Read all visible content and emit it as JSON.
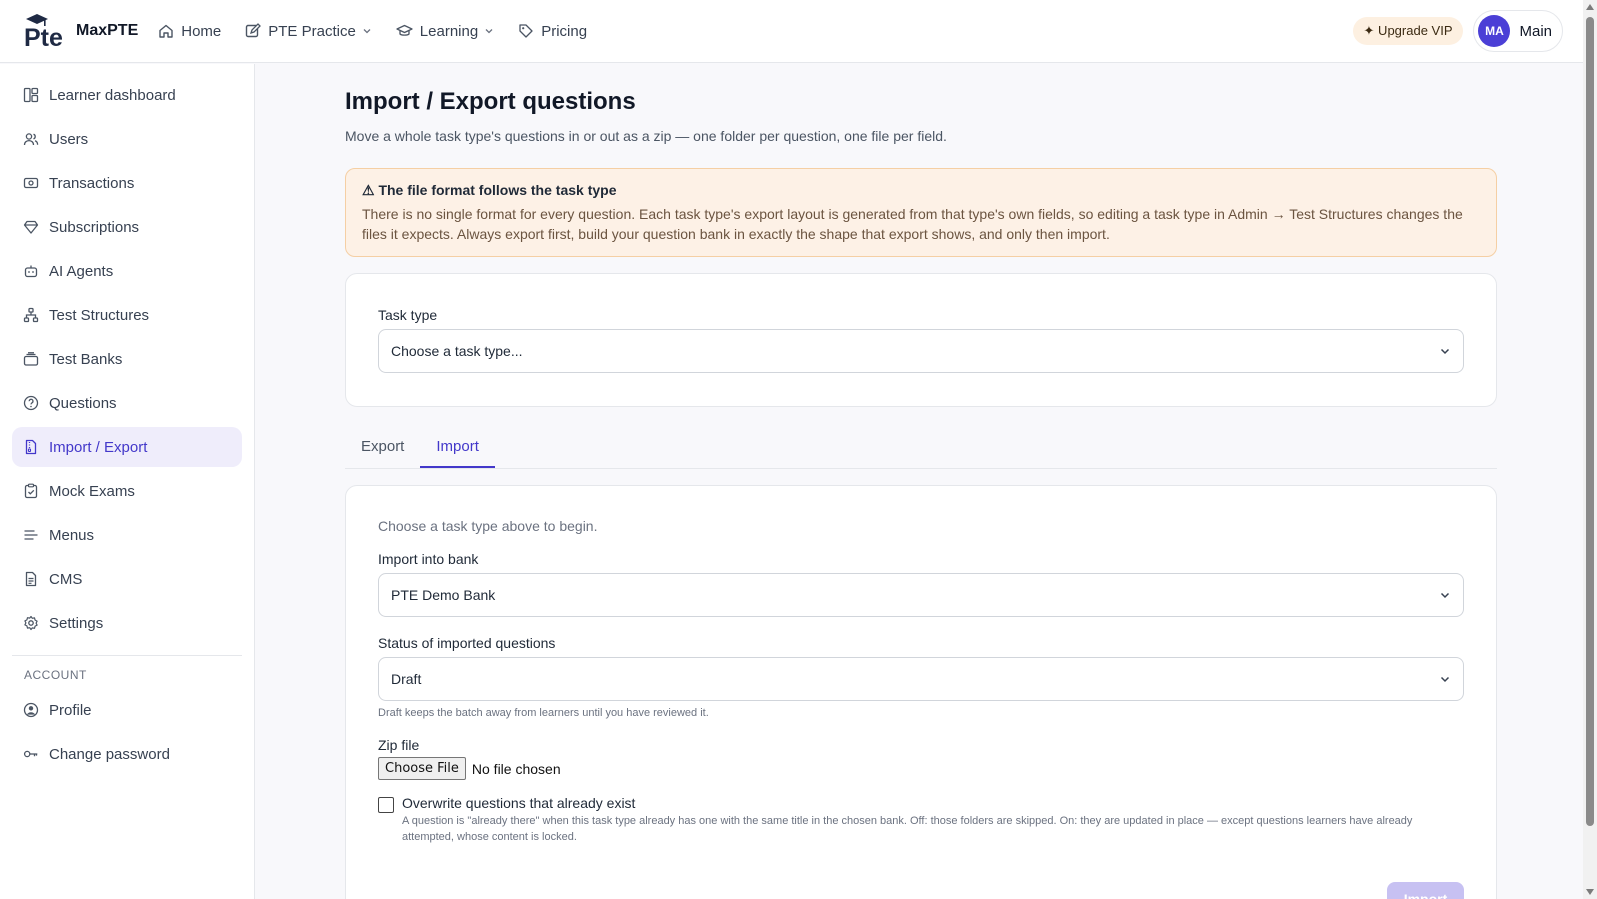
{
  "app": {
    "name": "MaxPTE",
    "logo_text": "Pte"
  },
  "topnav": {
    "items": [
      {
        "label": "Home",
        "icon": "home-icon",
        "has_dropdown": false
      },
      {
        "label": "PTE Practice",
        "icon": "edit-icon",
        "has_dropdown": true
      },
      {
        "label": "Learning",
        "icon": "graduation-cap-icon",
        "has_dropdown": true
      },
      {
        "label": "Pricing",
        "icon": "tag-icon",
        "has_dropdown": false
      }
    ],
    "upgrade_label": "✦ Upgrade VIP",
    "user": {
      "initials": "MA",
      "name": "Main"
    }
  },
  "sidebar": {
    "items": [
      {
        "label": "Learner dashboard",
        "icon": "dashboard-icon"
      },
      {
        "label": "Users",
        "icon": "users-icon"
      },
      {
        "label": "Transactions",
        "icon": "cash-icon"
      },
      {
        "label": "Subscriptions",
        "icon": "diamond-icon"
      },
      {
        "label": "AI Agents",
        "icon": "robot-icon"
      },
      {
        "label": "Test Structures",
        "icon": "hierarchy-icon"
      },
      {
        "label": "Test Banks",
        "icon": "stack-icon"
      },
      {
        "label": "Questions",
        "icon": "help-circle-icon"
      },
      {
        "label": "Import / Export",
        "icon": "file-zip-icon",
        "active": true
      },
      {
        "label": "Mock Exams",
        "icon": "clipboard-check-icon"
      },
      {
        "label": "Menus",
        "icon": "menu-icon"
      },
      {
        "label": "CMS",
        "icon": "document-icon"
      },
      {
        "label": "Settings",
        "icon": "gear-icon"
      }
    ],
    "account_heading": "ACCOUNT",
    "account_items": [
      {
        "label": "Profile",
        "icon": "user-circle-icon"
      },
      {
        "label": "Change password",
        "icon": "key-icon"
      }
    ]
  },
  "page": {
    "title": "Import / Export questions",
    "subtitle": "Move a whole task type's questions in or out as a zip — one folder per question, one file per field."
  },
  "alert": {
    "title": "⚠ The file format follows the task type",
    "body": "There is no single format for every question. Each task type's export layout is generated from that type's own fields, so editing a task type in Admin → Test Structures changes the files it expects. Always export first, build your question bank in exactly the shape that export shows, and only then import."
  },
  "task_type": {
    "label": "Task type",
    "value": "Choose a task type..."
  },
  "tabs": [
    {
      "label": "Export",
      "active": false
    },
    {
      "label": "Import",
      "active": true
    }
  ],
  "import_form": {
    "hint": "Choose a task type above to begin.",
    "bank_label": "Import into bank",
    "bank_value": "PTE Demo Bank",
    "status_label": "Status of imported questions",
    "status_value": "Draft",
    "status_help": "Draft keeps the batch away from learners until you have reviewed it.",
    "zip_label": "Zip file",
    "file_button": "Choose File",
    "file_status": "No file chosen",
    "overwrite_label": "Overwrite questions that already exist",
    "overwrite_checked": false,
    "overwrite_desc": "A question is \"already there\" when this task type already has one with the same title in the chosen bank. Off: those folders are skipped. On: they are updated in place — except questions learners have already attempted, whose content is locked.",
    "submit_label": "Import"
  },
  "colors": {
    "accent": "#4338ca",
    "accent_light": "#efedfb",
    "avatar": "#4b3fd6",
    "warning_bg": "#fdf1e6",
    "warning_border": "#f5cfa4",
    "button_disabled": "#c7c1f2"
  }
}
